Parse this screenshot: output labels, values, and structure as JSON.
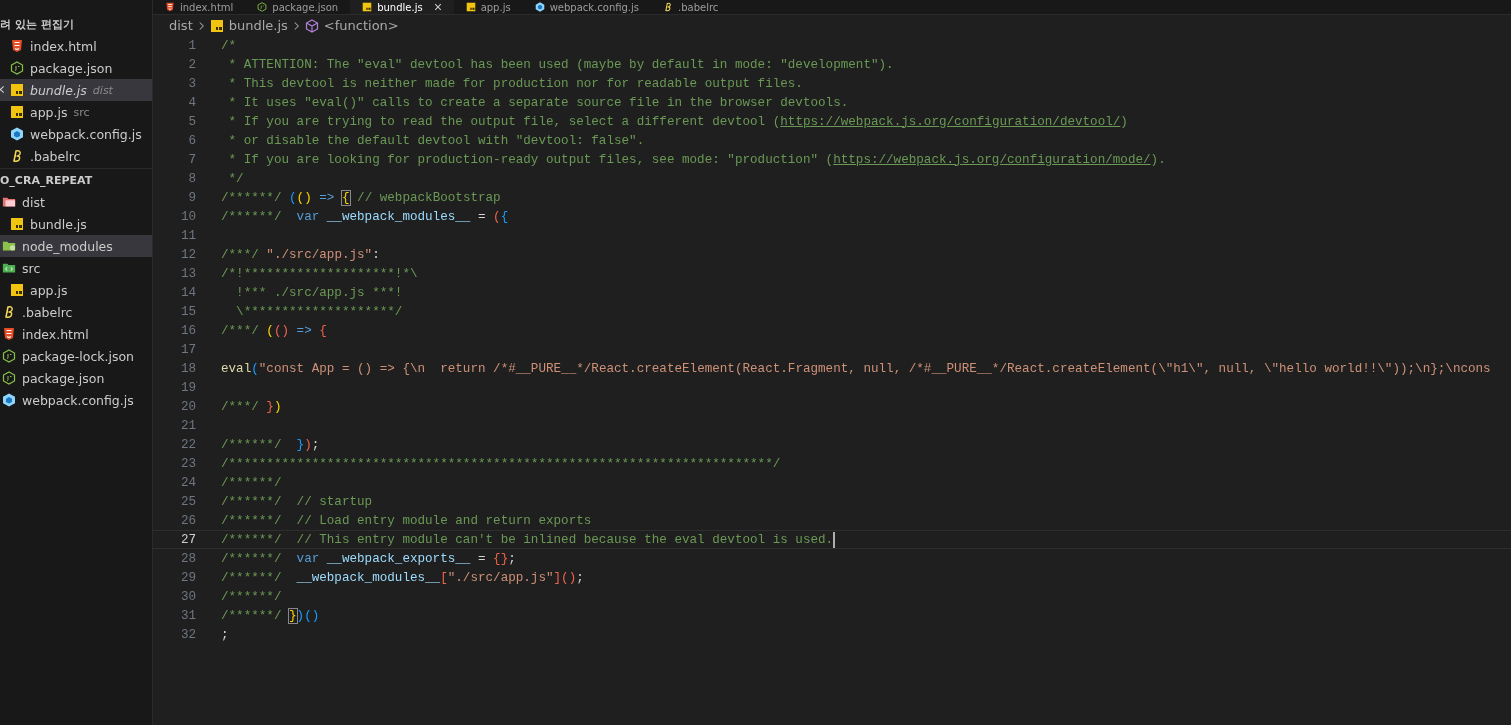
{
  "tabs": [
    {
      "label": "index.html",
      "kind": "html",
      "selected": false
    },
    {
      "label": "package.json",
      "kind": "json",
      "selected": false
    },
    {
      "label": "bundle.js",
      "kind": "js",
      "selected": true
    },
    {
      "label": "app.js",
      "kind": "js",
      "selected": false
    },
    {
      "label": "webpack.config.js",
      "kind": "webpack",
      "selected": false
    },
    {
      "label": ".babelrc",
      "kind": "babel",
      "selected": false
    }
  ],
  "sidebar": {
    "open_editors_title": "려 있는 편집기",
    "open_editors": [
      {
        "name": "index.html",
        "kind": "html",
        "selected": false,
        "preview": false
      },
      {
        "name": "package.json",
        "kind": "json",
        "selected": false,
        "preview": false
      },
      {
        "name": "bundle.js",
        "hint": "dist",
        "kind": "js",
        "selected": true,
        "preview": true
      },
      {
        "name": "app.js",
        "hint": "src",
        "kind": "js",
        "selected": false,
        "preview": false
      },
      {
        "name": "webpack.config.js",
        "kind": "webpack",
        "selected": false,
        "preview": false
      },
      {
        "name": ".babelrc",
        "kind": "babel",
        "selected": false,
        "preview": false
      }
    ],
    "project_title": "O_CRA_REPEAT",
    "files": [
      {
        "name": "dist",
        "kind": "folder-dist",
        "selected": false,
        "children": [
          {
            "name": "bundle.js",
            "kind": "js",
            "selected": false
          }
        ]
      },
      {
        "name": "node_modules",
        "kind": "folder-node",
        "selected": true
      },
      {
        "name": "src",
        "kind": "folder-src",
        "selected": false,
        "children": [
          {
            "name": "app.js",
            "kind": "js",
            "selected": false
          }
        ]
      },
      {
        "name": ".babelrc",
        "kind": "babel",
        "selected": false
      },
      {
        "name": "index.html",
        "kind": "html",
        "selected": false
      },
      {
        "name": "package-lock.json",
        "kind": "json",
        "selected": false
      },
      {
        "name": "package.json",
        "kind": "json",
        "selected": false
      },
      {
        "name": "webpack.config.js",
        "kind": "webpack",
        "selected": false
      }
    ]
  },
  "breadcrumbs": [
    {
      "label": "dist",
      "kind": "folder"
    },
    {
      "label": "bundle.js",
      "kind": "js"
    },
    {
      "label": "<function>",
      "kind": "function"
    }
  ],
  "editor": {
    "lines": [
      {
        "number": "1",
        "current": false,
        "tokens": [
          {
            "kind": "comment",
            "text": "/*"
          }
        ]
      },
      {
        "number": "2",
        "current": false,
        "tokens": [
          {
            "kind": "comment",
            "text": " * ATTENTION: The \"eval\" devtool has been used (maybe by default in mode: \"development\")."
          }
        ]
      },
      {
        "number": "3",
        "current": false,
        "tokens": [
          {
            "kind": "comment",
            "text": " * This devtool is neither made for production nor for readable output files."
          }
        ]
      },
      {
        "number": "4",
        "current": false,
        "tokens": [
          {
            "kind": "comment",
            "text": " * It uses \"eval()\" calls to create a separate source file in the browser devtools."
          }
        ]
      },
      {
        "number": "5",
        "current": false,
        "tokens": [
          {
            "kind": "comment",
            "text": " * If you are trying to read the output file, select a different devtool ("
          },
          {
            "kind": "link",
            "text": "https://webpack.js.org/configuration/devtool/"
          },
          {
            "kind": "comment",
            "text": ")"
          }
        ]
      },
      {
        "number": "6",
        "current": false,
        "tokens": [
          {
            "kind": "comment",
            "text": " * or disable the default devtool with \"devtool: false\"."
          }
        ]
      },
      {
        "number": "7",
        "current": false,
        "tokens": [
          {
            "kind": "comment",
            "text": " * If you are looking for production-ready output files, see mode: \"production\" ("
          },
          {
            "kind": "link",
            "text": "https://webpack.js.org/configuration/mode/"
          },
          {
            "kind": "comment",
            "text": ")."
          }
        ]
      },
      {
        "number": "8",
        "current": false,
        "tokens": [
          {
            "kind": "comment",
            "text": " */"
          }
        ]
      },
      {
        "number": "9",
        "current": false,
        "tokens": [
          {
            "kind": "comment",
            "text": "/******/ "
          },
          {
            "kind": "bracket3",
            "text": "("
          },
          {
            "kind": "bracket1",
            "text": "()"
          },
          {
            "kind": "keyword",
            "text": " => "
          },
          {
            "kind": "bracket-match",
            "text": "{"
          },
          {
            "kind": "comment",
            "text": " // webpackBootstrap"
          }
        ]
      },
      {
        "number": "10",
        "current": false,
        "tokens": [
          {
            "kind": "comment",
            "text": "/******/  "
          },
          {
            "kind": "keyword",
            "text": "var "
          },
          {
            "kind": "variable",
            "text": "__webpack_modules__"
          },
          {
            "kind": "plain",
            "text": " = "
          },
          {
            "kind": "bracket2",
            "text": "("
          },
          {
            "kind": "bracket3",
            "text": "{"
          }
        ]
      },
      {
        "number": "11",
        "current": false
      },
      {
        "number": "12",
        "current": false,
        "tokens": [
          {
            "kind": "comment",
            "text": "/***/ "
          },
          {
            "kind": "string",
            "text": "\"./src/app.js\""
          },
          {
            "kind": "plain",
            "text": ":"
          }
        ]
      },
      {
        "number": "13",
        "current": false,
        "tokens": [
          {
            "kind": "comment",
            "text": "/*!********************!*\\"
          }
        ]
      },
      {
        "number": "14",
        "current": false,
        "tokens": [
          {
            "kind": "comment",
            "text": "  !*** ./src/app.js ***!"
          }
        ]
      },
      {
        "number": "15",
        "current": false,
        "tokens": [
          {
            "kind": "comment",
            "text": "  \\********************/"
          }
        ]
      },
      {
        "number": "16",
        "current": false,
        "tokens": [
          {
            "kind": "comment",
            "text": "/***/ "
          },
          {
            "kind": "bracket1",
            "text": "("
          },
          {
            "kind": "bracket2",
            "text": "()"
          },
          {
            "kind": "keyword",
            "text": " => "
          },
          {
            "kind": "bracket2",
            "text": "{"
          }
        ]
      },
      {
        "number": "17",
        "current": false
      },
      {
        "number": "18",
        "current": false,
        "tokens": [
          {
            "kind": "function",
            "text": "eval"
          },
          {
            "kind": "bracket3",
            "text": "("
          },
          {
            "kind": "string",
            "text": "\"const App = () => {\\n  return /*#__PURE__*/React.createElement(React.Fragment, null, /*#__PURE__*/React.createElement(\\\"h1\\\", null, \\\"hello world!!\\\"));\\n};\\ncons"
          }
        ]
      },
      {
        "number": "19",
        "current": false
      },
      {
        "number": "20",
        "current": false,
        "tokens": [
          {
            "kind": "comment",
            "text": "/***/ "
          },
          {
            "kind": "bracket2",
            "text": "}"
          },
          {
            "kind": "bracket1",
            "text": ")"
          }
        ]
      },
      {
        "number": "21",
        "current": false
      },
      {
        "number": "22",
        "current": false,
        "tokens": [
          {
            "kind": "comment",
            "text": "/******/  "
          },
          {
            "kind": "bracket3",
            "text": "}"
          },
          {
            "kind": "bracket2",
            "text": ")"
          },
          {
            "kind": "plain",
            "text": ";"
          }
        ]
      },
      {
        "number": "23",
        "current": false,
        "tokens": [
          {
            "kind": "comment",
            "text": "/************************************************************************/"
          }
        ]
      },
      {
        "number": "24",
        "current": false,
        "tokens": [
          {
            "kind": "comment",
            "text": "/******/"
          }
        ]
      },
      {
        "number": "25",
        "current": false,
        "tokens": [
          {
            "kind": "comment",
            "text": "/******/  // startup"
          }
        ]
      },
      {
        "number": "26",
        "current": false,
        "tokens": [
          {
            "kind": "comment",
            "text": "/******/  // Load entry module and return exports"
          }
        ]
      },
      {
        "number": "27",
        "current": true,
        "tokens": [
          {
            "kind": "comment",
            "text": "/******/  // This entry module can't be inlined because the eval devtool is used."
          }
        ]
      },
      {
        "number": "28",
        "current": false,
        "tokens": [
          {
            "kind": "comment",
            "text": "/******/  "
          },
          {
            "kind": "keyword",
            "text": "var "
          },
          {
            "kind": "variable",
            "text": "__webpack_exports__"
          },
          {
            "kind": "plain",
            "text": " = "
          },
          {
            "kind": "bracket2",
            "text": "{}"
          },
          {
            "kind": "plain",
            "text": ";"
          }
        ]
      },
      {
        "number": "29",
        "current": false,
        "tokens": [
          {
            "kind": "comment",
            "text": "/******/  "
          },
          {
            "kind": "variable",
            "text": "__webpack_modules__"
          },
          {
            "kind": "bracket2",
            "text": "["
          },
          {
            "kind": "string",
            "text": "\"./src/app.js\""
          },
          {
            "kind": "bracket2",
            "text": "]"
          },
          {
            "kind": "bracket2",
            "text": "()"
          },
          {
            "kind": "plain",
            "text": ";"
          }
        ]
      },
      {
        "number": "30",
        "current": false,
        "tokens": [
          {
            "kind": "comment",
            "text": "/******/"
          }
        ]
      },
      {
        "number": "31",
        "current": false,
        "tokens": [
          {
            "kind": "comment",
            "text": "/******/ "
          },
          {
            "kind": "bracket-match",
            "text": "}"
          },
          {
            "kind": "bracket3",
            "text": ")()"
          }
        ]
      },
      {
        "number": "32",
        "current": false,
        "tokens": [
          {
            "kind": "plain",
            "text": ";"
          }
        ]
      }
    ]
  }
}
